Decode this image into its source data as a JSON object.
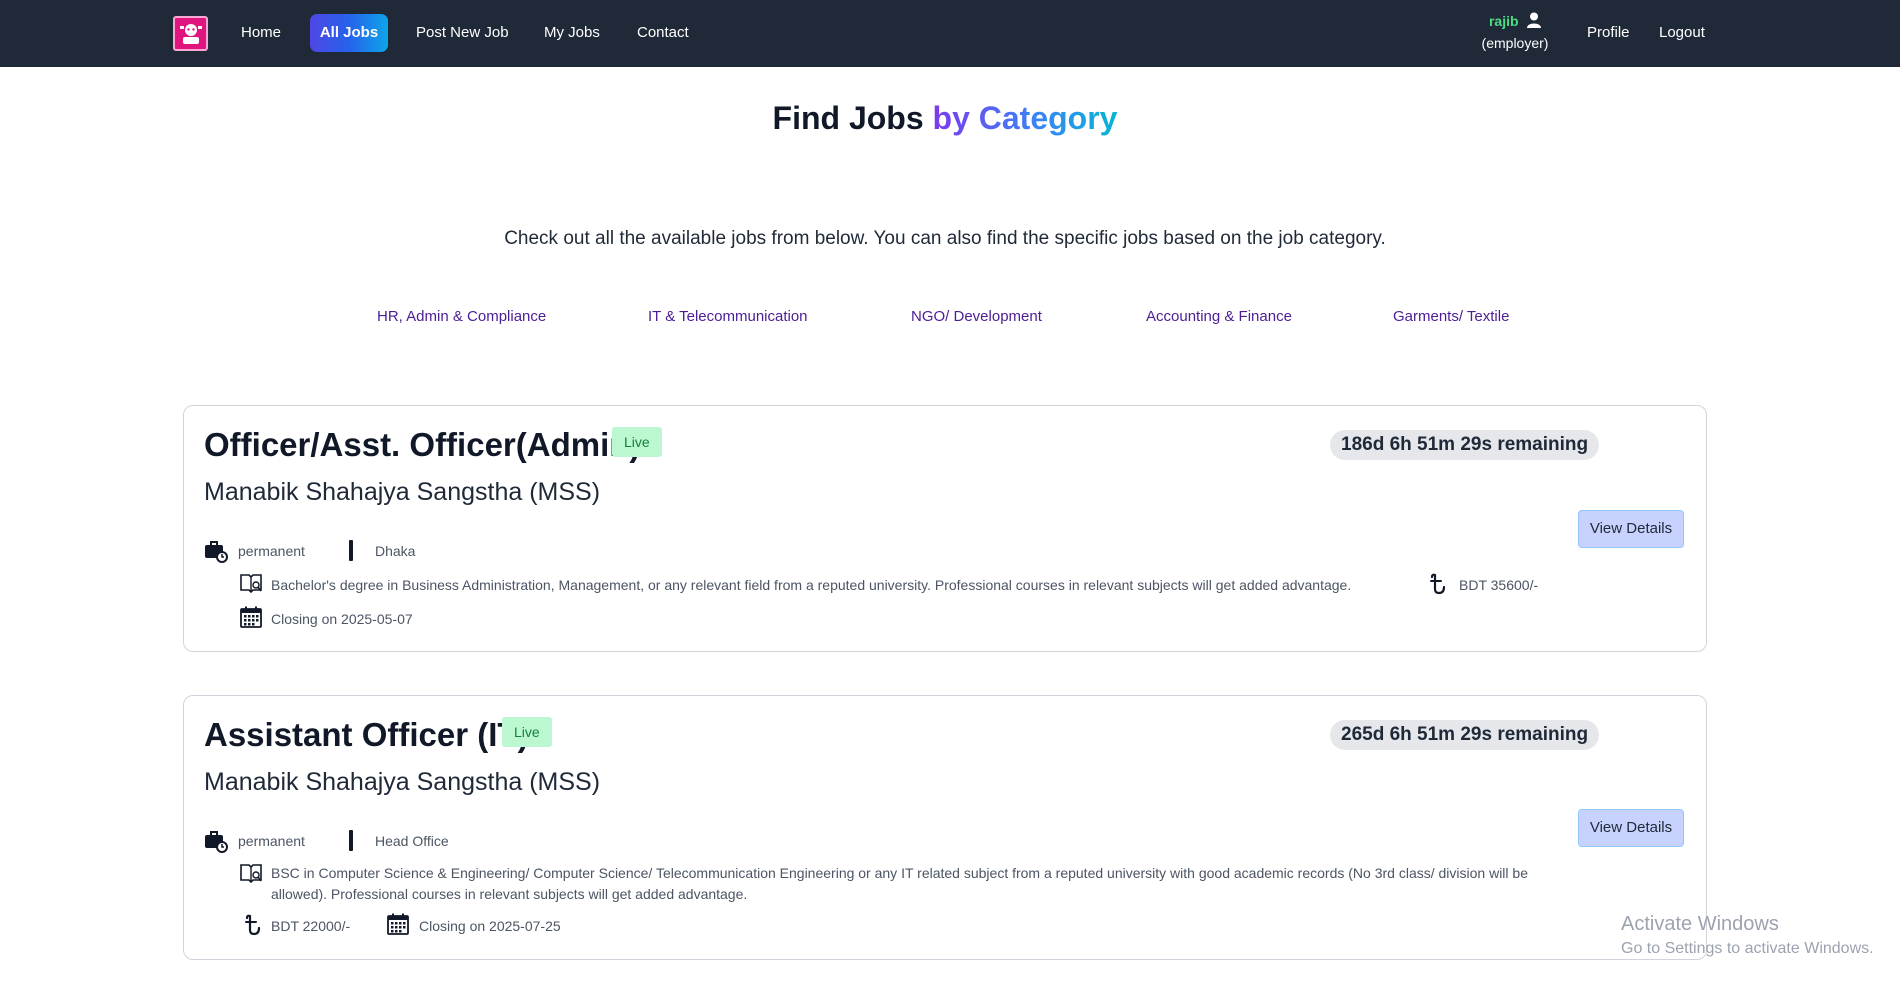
{
  "nav": {
    "home": "Home",
    "all_jobs": "All Jobs",
    "post_new_job": "Post New Job",
    "my_jobs": "My Jobs",
    "contact": "Contact",
    "username": "rajib",
    "role": "(employer)",
    "profile": "Profile",
    "logout": "Logout"
  },
  "hero": {
    "title_plain": "Find Jobs",
    "title_gradient": "by Category",
    "subtitle": "Check out all the available jobs from below. You can also find the specific jobs based on the job category."
  },
  "categories": [
    "HR, Admin & Compliance",
    "IT & Telecommunication",
    "NGO/ Development",
    "Accounting & Finance",
    "Garments/ Textile"
  ],
  "jobs": [
    {
      "title": "Officer/Asst. Officer(Admin)",
      "status": "Live",
      "company": "Manabik Shahajya Sangstha (MSS)",
      "remaining": "186d 6h 51m 29s remaining",
      "type": "permanent",
      "location": "Dhaka",
      "education": "Bachelor's degree in Business Administration, Management, or any relevant field from a reputed university. Professional courses in relevant subjects will get added advantage.",
      "salary": "BDT 35600/-",
      "closing": "Closing on 2025-05-07",
      "button": "View Details"
    },
    {
      "title": "Assistant Officer (IT)",
      "status": "Live",
      "company": "Manabik Shahajya Sangstha (MSS)",
      "remaining": "265d 6h 51m 29s remaining",
      "type": "permanent",
      "location": "Head Office",
      "education": "BSC in Computer Science & Engineering/ Computer Science/ Telecommunication Engineering or any IT related subject from a reputed university with good academic records (No 3rd class/ division will be allowed). Professional courses in relevant subjects will get added advantage.",
      "salary": "BDT 22000/-",
      "closing": "Closing on 2025-07-25",
      "button": "View Details"
    }
  ],
  "watermark": {
    "line1": "Activate Windows",
    "line2": "Go to Settings to activate Windows."
  },
  "colors": {
    "navbar": "#1f2937",
    "accent_gradient_start": "#7c3aed",
    "accent_gradient_end": "#06b6d4",
    "live_badge": "#bbf7d0",
    "username": "#4ade80",
    "category_link": "#4c1d95"
  }
}
